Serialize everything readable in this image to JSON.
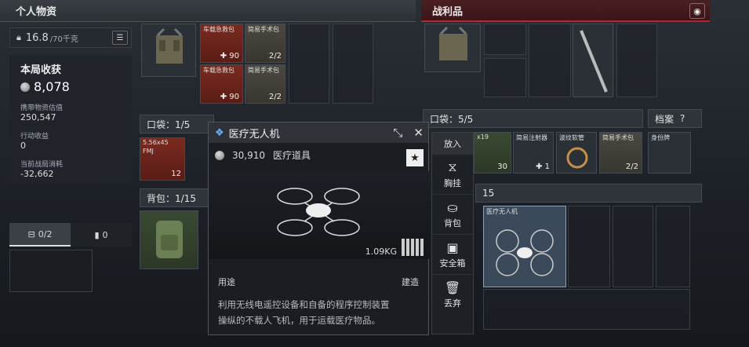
{
  "headers": {
    "left": "个人物资",
    "right": "战利品",
    "pin_icon": "location-pin-icon"
  },
  "weight": {
    "value": "16.8",
    "unit": "/70千克"
  },
  "stats": {
    "title": "本局收获",
    "total": "8,078",
    "carried_label": "携带物资估值",
    "carried_value": "250,547",
    "action_label": "行动收益",
    "action_value": "0",
    "spent_label": "当前战局消耗",
    "spent_value": "-32,662"
  },
  "tabs": [
    {
      "label": "0/2"
    },
    {
      "label": "0"
    }
  ],
  "left_items": {
    "aid1": {
      "tag": "车载急救包",
      "count": "90"
    },
    "surg1": {
      "tag": "简易手术包",
      "count": "2/2"
    },
    "aid2": {
      "tag": "车载急救包",
      "count": "90"
    },
    "surg2": {
      "tag": "简易手术包",
      "count": "2/2"
    },
    "ammo": {
      "tag": "5.56x45",
      "sub": "FMJ",
      "count": "12"
    }
  },
  "sections": {
    "pocket_left": "口袋：1/5",
    "backpack_left": "背包：1/15",
    "pocket_right": "口袋：5/5",
    "archive": "档案",
    "right_bag_count": "15"
  },
  "right_items": {
    "i1": {
      "tag": "x19",
      "count": "30"
    },
    "i2": {
      "tag": "简易注射器",
      "count": "1"
    },
    "i3": {
      "tag": "波纹软管"
    },
    "i4": {
      "tag": "简易手术包",
      "count": "2/2"
    },
    "i5": {
      "tag": "身份牌"
    },
    "drone": {
      "tag": "医疗无人机"
    }
  },
  "popup": {
    "title": "医疗无人机",
    "price": "30,910",
    "category": "医疗道具",
    "weight": "1.09KG",
    "use_label": "用途",
    "use_value": "建造",
    "desc_line1": "利用无线电遥控设备和自备的程序控制装置",
    "desc_line2": "操纵的不载人飞机，用于运载医疗物品。"
  },
  "actions": {
    "put": "放入",
    "chest": "胸挂",
    "bag": "背包",
    "safe": "安全箱",
    "drop": "丢弃"
  }
}
